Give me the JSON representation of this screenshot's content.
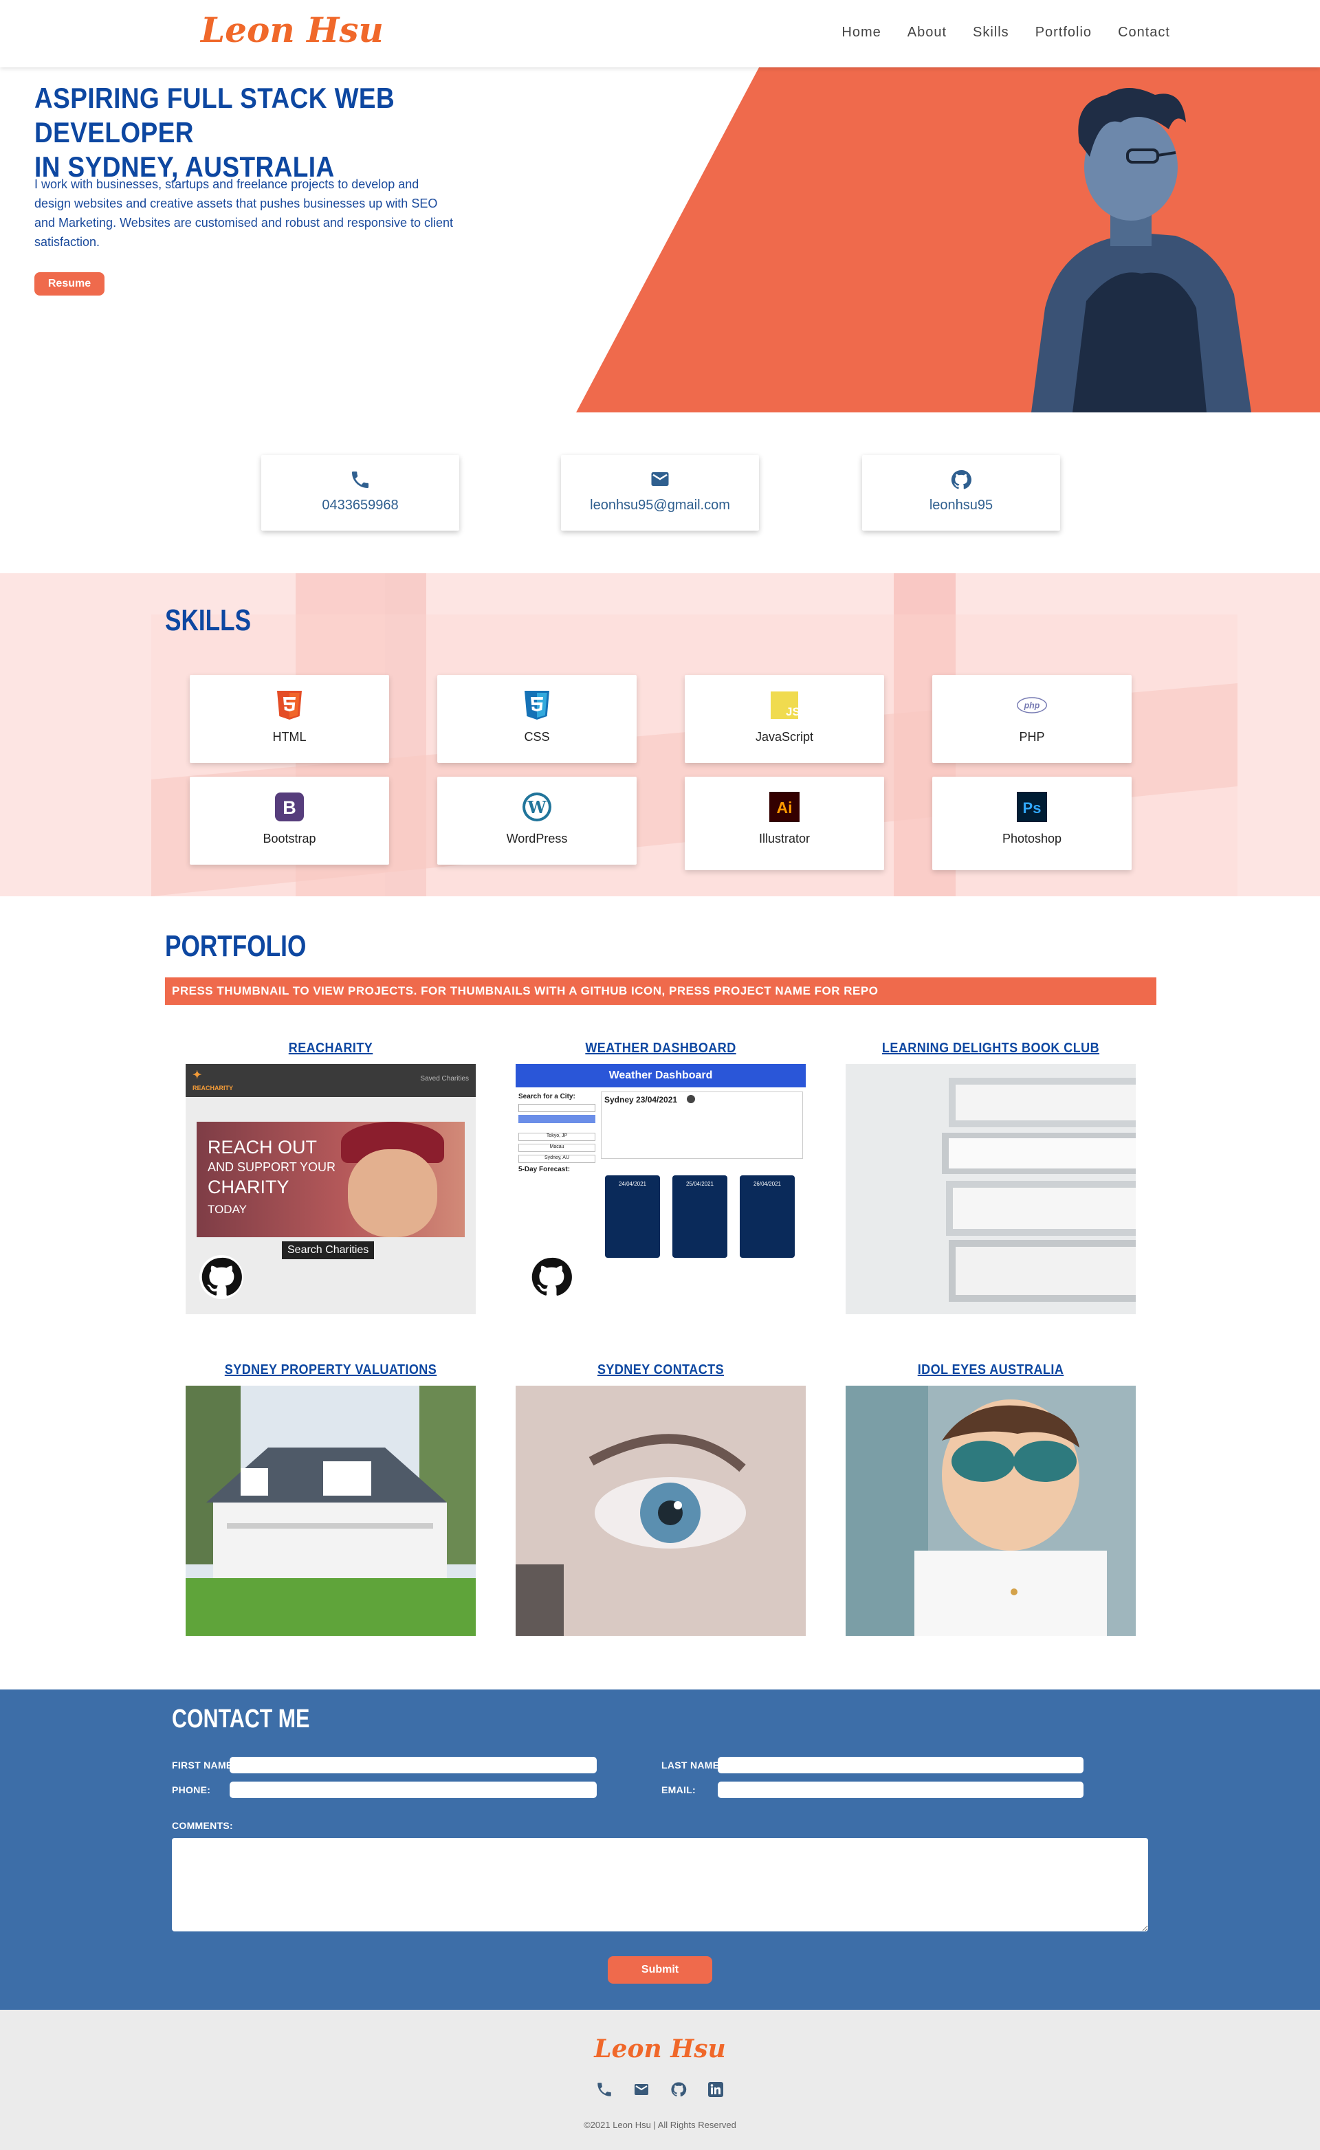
{
  "nav": {
    "logo": "Leon Hsu",
    "links": [
      "Home",
      "About",
      "Skills",
      "Portfolio",
      "Contact"
    ]
  },
  "hero": {
    "title_line1": "Aspiring Full Stack Web Developer",
    "title_line2": "in Sydney, Australia",
    "description": "I work with businesses, startups and freelance projects to develop and design websites and creative assets that pushes businesses up with SEO and Marketing. Websites are customised and robust and responsive to client satisfaction.",
    "resume_label": "Resume",
    "accent_color": "#ef6a4c"
  },
  "contact_cards": [
    {
      "icon": "phone-icon",
      "value": "0433659968"
    },
    {
      "icon": "envelope-icon",
      "value": "leonhsu95@gmail.com"
    },
    {
      "icon": "github-icon",
      "value": "leonhsu95"
    }
  ],
  "skills": {
    "title": "Skills",
    "items": [
      {
        "label": "HTML",
        "icon": "html5-icon",
        "color": "#e44d26"
      },
      {
        "label": "CSS",
        "icon": "css3-icon",
        "color": "#1572b6"
      },
      {
        "label": "JavaScript",
        "icon": "javascript-icon",
        "color": "#f0db4f"
      },
      {
        "label": "PHP",
        "icon": "php-icon",
        "color": "#777bb3"
      },
      {
        "label": "Bootstrap",
        "icon": "bootstrap-icon",
        "color": "#563d7c"
      },
      {
        "label": "WordPress",
        "icon": "wordpress-icon",
        "color": "#21759b"
      },
      {
        "label": "Illustrator",
        "icon": "illustrator-icon",
        "color": "#330000"
      },
      {
        "label": "Photoshop",
        "icon": "photoshop-icon",
        "color": "#001d34"
      }
    ]
  },
  "portfolio": {
    "title": "Portfolio",
    "banner": "Press thumbnail to view projects. For thumbnails with a github icon, press project name for repo",
    "projects": [
      {
        "name": "ReaCharity",
        "has_github": true,
        "thumb": {
          "brand": "REACHARITY",
          "saved": "Saved Charities",
          "line1": "REACH OUT",
          "line2": "AND SUPPORT YOUR",
          "line3": "CHARITY",
          "line4": "TODAY",
          "search": "Search Charities"
        }
      },
      {
        "name": "Weather Dashboard",
        "has_github": true,
        "thumb": {
          "header": "Weather Dashboard",
          "search_label": "Search for a City:",
          "city": "Sydney 23/04/2021",
          "forecast_label": "5-Day Forecast:",
          "days": [
            "24/04/2021",
            "25/04/2021",
            "26/04/2021"
          ],
          "cities": [
            "Sydney, AU",
            "Tokyo, JP",
            "Macau",
            "Sydney, AU"
          ]
        }
      },
      {
        "name": "Learning Delights Book Club",
        "has_github": false
      },
      {
        "name": "Sydney Property Valuations",
        "has_github": false
      },
      {
        "name": "Sydney Contacts",
        "has_github": false
      },
      {
        "name": "Idol Eyes Australia",
        "has_github": false
      }
    ]
  },
  "contact": {
    "title": "Contact Me",
    "first_name_label": "First Name:",
    "last_name_label": "Last Name:",
    "phone_label": "Phone:",
    "email_label": "Email:",
    "comments_label": "Comments:",
    "submit_label": "Submit"
  },
  "footer": {
    "logo": "Leon Hsu",
    "icons": [
      "phone-icon",
      "envelope-icon",
      "github-icon",
      "linkedin-icon"
    ],
    "copyright": "©2021 Leon Hsu | All Rights Reserved"
  }
}
